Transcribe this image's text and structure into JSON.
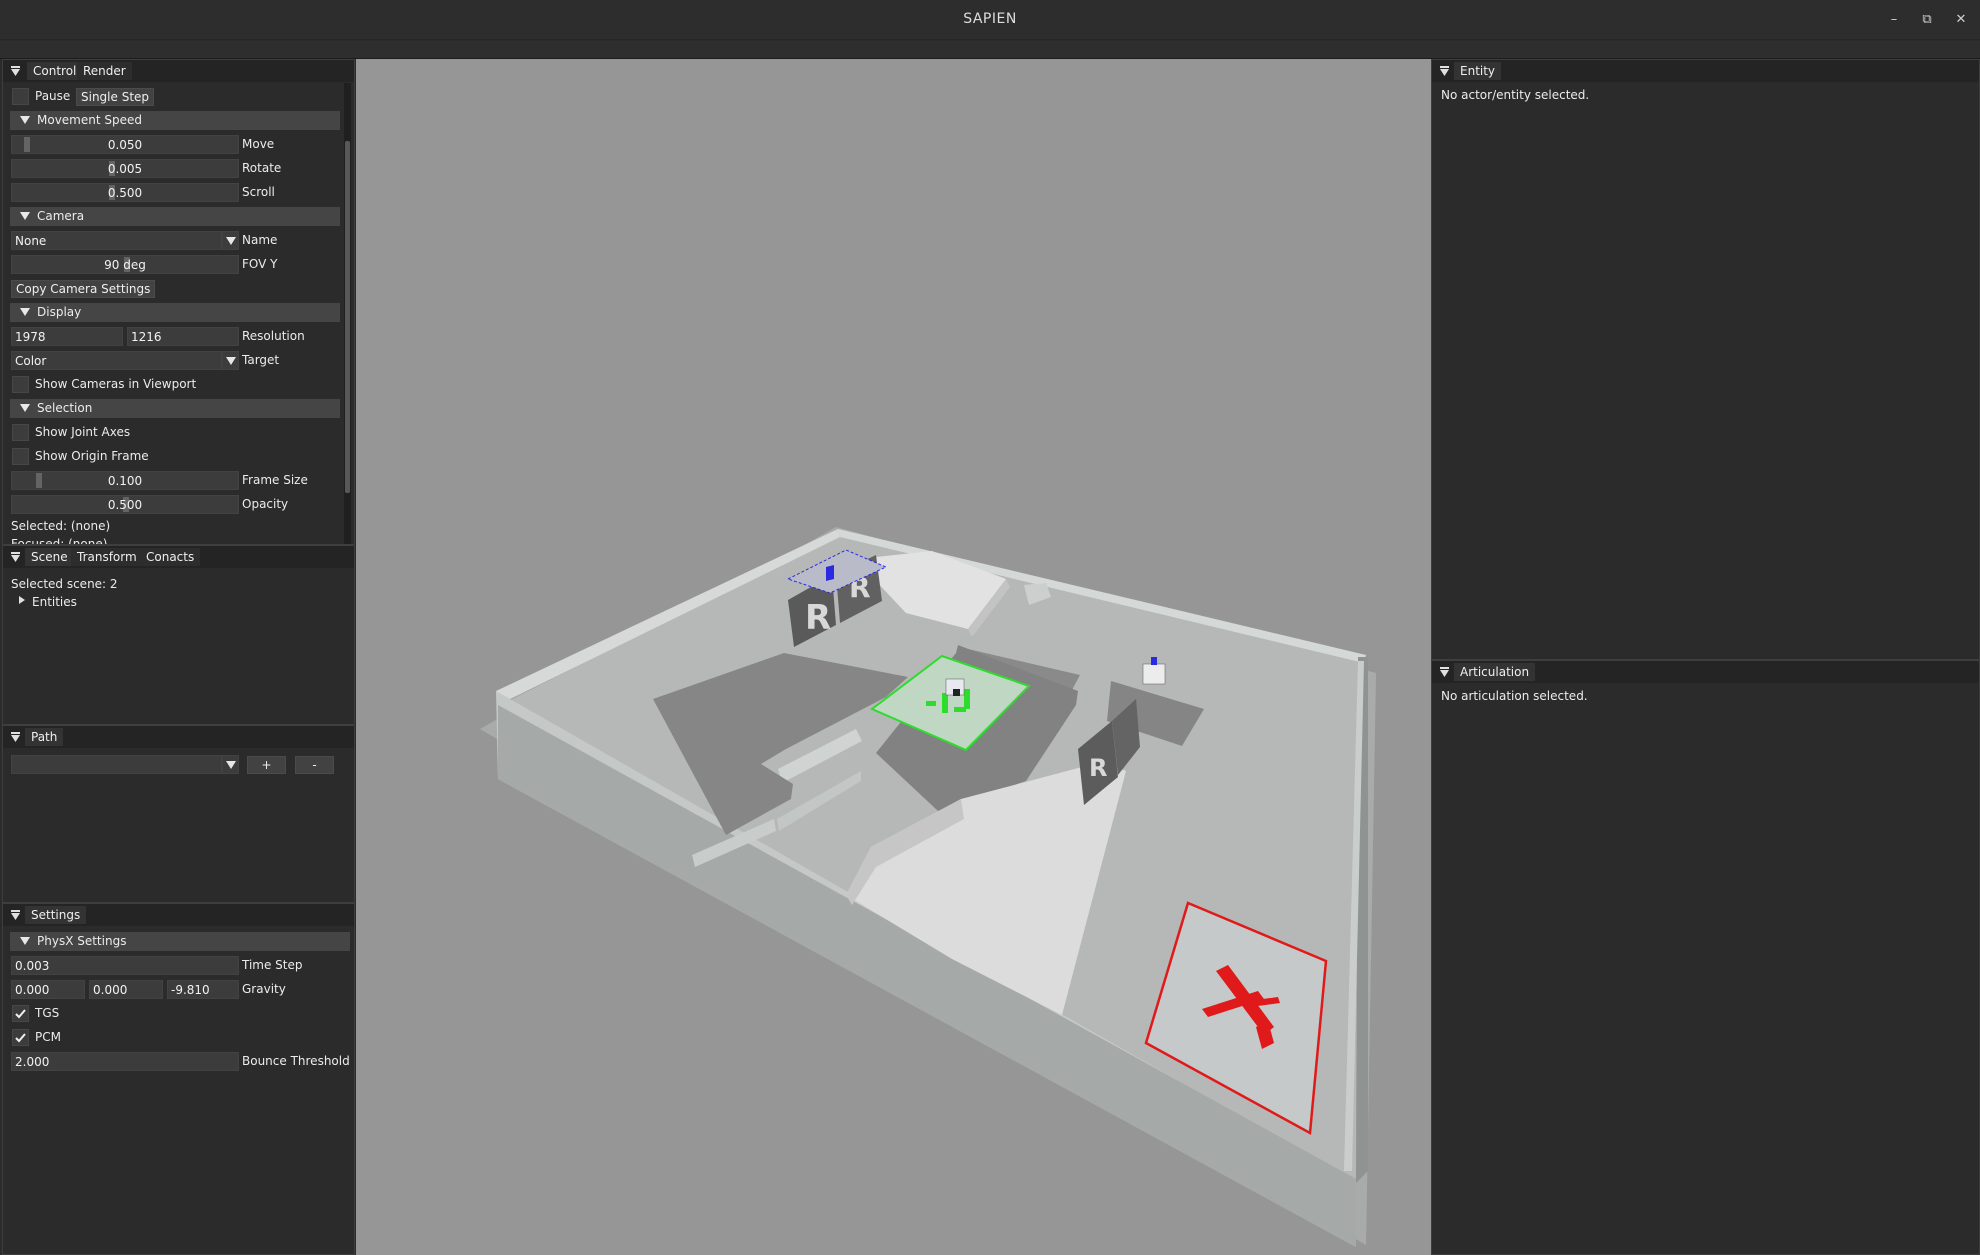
{
  "window": {
    "title": "SAPIEN"
  },
  "window_controls": {
    "minimize": "–",
    "restore": "⧉",
    "close": "✕"
  },
  "control_panel": {
    "tabs": [
      "Control",
      "Render"
    ],
    "pause_label": "Pause",
    "pause_checked": false,
    "single_step_label": "Single Step",
    "movement_speed": {
      "header": "Movement Speed",
      "move": {
        "value": "0.050",
        "label": "Move",
        "fraction": 0.01
      },
      "rotate": {
        "value": "0.005",
        "label": "Rotate",
        "fraction": 0.44
      },
      "scroll": {
        "value": "0.500",
        "label": "Scroll",
        "fraction": 0.44
      }
    },
    "camera": {
      "header": "Camera",
      "name_value": "None",
      "name_label": "Name",
      "fov_value": "90 deg",
      "fov_label": "FOV Y",
      "fov_fraction": 0.5,
      "copy_button": "Copy Camera Settings"
    },
    "display": {
      "header": "Display",
      "resolution_width": "1978",
      "resolution_height": "1216",
      "resolution_label": "Resolution",
      "target_value": "Color",
      "target_label": "Target",
      "show_cameras_label": "Show Cameras in Viewport",
      "show_cameras_checked": false
    },
    "selection": {
      "header": "Selection",
      "show_joint_axes_label": "Show Joint Axes",
      "show_joint_axes_checked": false,
      "show_origin_frame_label": "Show Origin Frame",
      "show_origin_frame_checked": false,
      "frame_size": {
        "value": "0.100",
        "label": "Frame Size",
        "fraction": 0.1
      },
      "opacity": {
        "value": "0.500",
        "label": "Opacity",
        "fraction": 0.5
      },
      "selected_text": "Selected: (none)",
      "clipped_text": "Focused: (none)"
    }
  },
  "scene_panel": {
    "tabs": [
      "Scene",
      "Transform",
      "Conacts"
    ],
    "selected_scene": "Selected scene: 2",
    "tree_entities": "Entities"
  },
  "path_panel": {
    "tab": "Path",
    "path_value": "",
    "add_button": "+",
    "remove_button": "-"
  },
  "settings_panel": {
    "tab": "Settings",
    "physx": {
      "header": "PhysX Settings",
      "time_step_value": "0.003",
      "time_step_label": "Time Step",
      "gravity": [
        "0.000",
        "0.000",
        "-9.810"
      ],
      "gravity_label": "Gravity",
      "tgs_label": "TGS",
      "tgs_checked": true,
      "pcm_label": "PCM",
      "pcm_checked": true,
      "bounce_value": "2.000",
      "bounce_label": "Bounce Threshold"
    }
  },
  "entity_panel": {
    "tab": "Entity",
    "message": "No actor/entity selected."
  },
  "articulation_panel": {
    "tab": "Articulation",
    "message": "No articulation selected."
  },
  "viewport": {
    "colors": {
      "background": "#969696",
      "floor": "#b3b5b4",
      "wall": "#c3c8c6",
      "carpet": "#858585",
      "ramp": "#dadada",
      "green_zone": "#c0d7c3",
      "green_accent": "#2ddc2d",
      "red_zone": "#c4c8c8",
      "red_accent": "#e01a1a",
      "blue_accent": "#2a2ae0"
    }
  }
}
